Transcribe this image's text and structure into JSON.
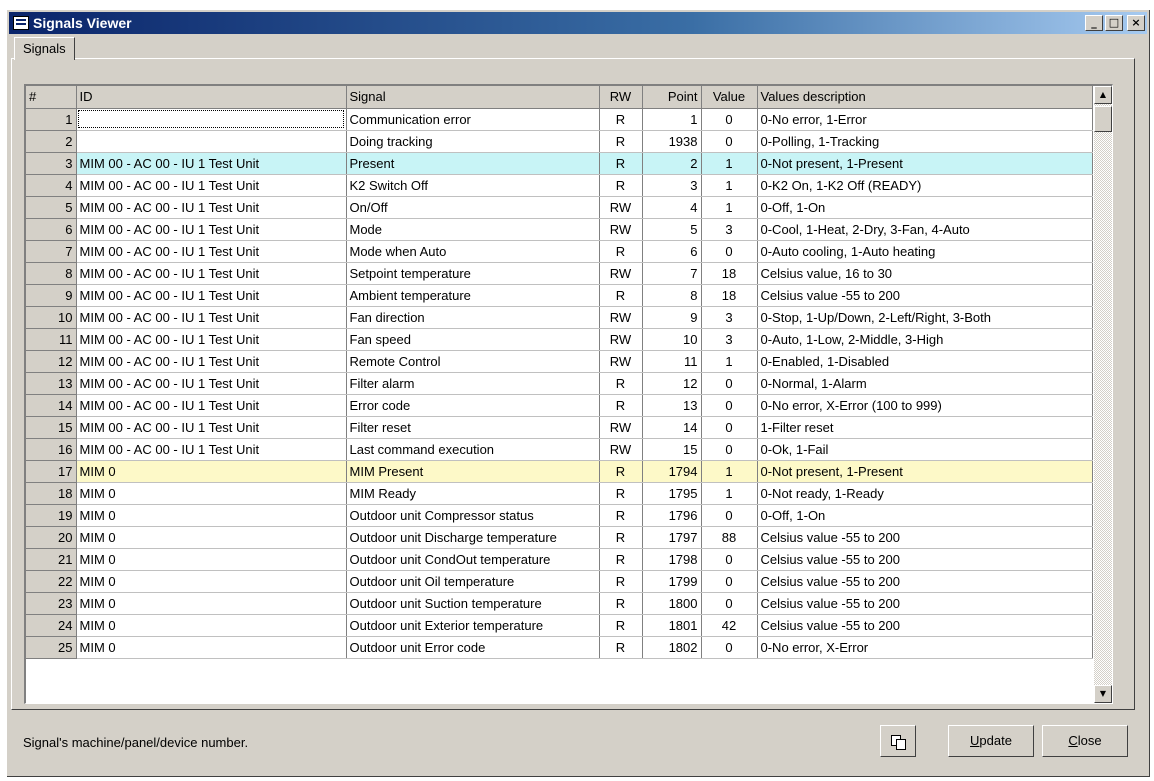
{
  "window": {
    "title": "Signals Viewer",
    "min": "_",
    "max": "□",
    "close": "×"
  },
  "tab": {
    "label": "Signals"
  },
  "table": {
    "columns": [
      "#",
      "ID",
      "Signal",
      "RW",
      "Point",
      "Value",
      "Values description"
    ],
    "rows": [
      [
        "1",
        "",
        "Communication error",
        "R",
        "1",
        "0",
        "0-No error, 1-Error"
      ],
      [
        "2",
        "",
        "Doing tracking",
        "R",
        "1938",
        "0",
        "0-Polling, 1-Tracking"
      ],
      [
        "3",
        "MIM 00 - AC 00 - IU 1 Test Unit",
        "Present",
        "R",
        "2",
        "1",
        "0-Not present, 1-Present"
      ],
      [
        "4",
        "MIM 00 - AC 00 - IU 1 Test Unit",
        "K2 Switch Off",
        "R",
        "3",
        "1",
        "0-K2 On, 1-K2 Off (READY)"
      ],
      [
        "5",
        "MIM 00 - AC 00 - IU 1 Test Unit",
        "On/Off",
        "RW",
        "4",
        "1",
        "0-Off, 1-On"
      ],
      [
        "6",
        "MIM 00 - AC 00 - IU 1 Test Unit",
        "Mode",
        "RW",
        "5",
        "3",
        "0-Cool, 1-Heat, 2-Dry, 3-Fan, 4-Auto"
      ],
      [
        "7",
        "MIM 00 - AC 00 - IU 1 Test Unit",
        "Mode when Auto",
        "R",
        "6",
        "0",
        "0-Auto cooling, 1-Auto heating"
      ],
      [
        "8",
        "MIM 00 - AC 00 - IU 1 Test Unit",
        "Setpoint temperature",
        "RW",
        "7",
        "18",
        "Celsius value, 16 to 30"
      ],
      [
        "9",
        "MIM 00 - AC 00 - IU 1 Test Unit",
        "Ambient temperature",
        "R",
        "8",
        "18",
        "Celsius value -55 to 200"
      ],
      [
        "10",
        "MIM 00 - AC 00 - IU 1 Test Unit",
        "Fan direction",
        "RW",
        "9",
        "3",
        "0-Stop, 1-Up/Down, 2-Left/Right, 3-Both"
      ],
      [
        "11",
        "MIM 00 - AC 00 - IU 1 Test Unit",
        "Fan speed",
        "RW",
        "10",
        "3",
        "0-Auto, 1-Low, 2-Middle, 3-High"
      ],
      [
        "12",
        "MIM 00 - AC 00 - IU 1 Test Unit",
        "Remote Control",
        "RW",
        "11",
        "1",
        "0-Enabled, 1-Disabled"
      ],
      [
        "13",
        "MIM 00 - AC 00 - IU 1 Test Unit",
        "Filter alarm",
        "R",
        "12",
        "0",
        "0-Normal, 1-Alarm"
      ],
      [
        "14",
        "MIM 00 - AC 00 - IU 1 Test Unit",
        "Error code",
        "R",
        "13",
        "0",
        "0-No error, X-Error (100 to 999)"
      ],
      [
        "15",
        "MIM 00 - AC 00 - IU 1 Test Unit",
        "Filter reset",
        "RW",
        "14",
        "0",
        "1-Filter reset"
      ],
      [
        "16",
        "MIM 00 - AC 00 - IU 1 Test Unit",
        "Last command execution",
        "RW",
        "15",
        "0",
        "0-Ok, 1-Fail"
      ],
      [
        "17",
        "MIM 0",
        "MIM Present",
        "R",
        "1794",
        "1",
        "0-Not present, 1-Present"
      ],
      [
        "18",
        "MIM 0",
        "MIM Ready",
        "R",
        "1795",
        "1",
        "0-Not ready, 1-Ready"
      ],
      [
        "19",
        "MIM 0",
        "Outdoor unit Compressor status",
        "R",
        "1796",
        "0",
        "0-Off, 1-On"
      ],
      [
        "20",
        "MIM 0",
        "Outdoor unit Discharge temperature",
        "R",
        "1797",
        "88",
        "Celsius value -55 to 200"
      ],
      [
        "21",
        "MIM 0",
        "Outdoor unit CondOut temperature",
        "R",
        "1798",
        "0",
        "Celsius value -55 to 200"
      ],
      [
        "22",
        "MIM 0",
        "Outdoor unit Oil temperature",
        "R",
        "1799",
        "0",
        "Celsius value -55 to 200"
      ],
      [
        "23",
        "MIM 0",
        "Outdoor unit Suction temperature",
        "R",
        "1800",
        "0",
        "Celsius value -55 to 200"
      ],
      [
        "24",
        "MIM 0",
        "Outdoor unit Exterior temperature",
        "R",
        "1801",
        "42",
        "Celsius value -55 to 200"
      ],
      [
        "25",
        "MIM 0",
        "Outdoor unit Error code",
        "R",
        "1802",
        "0",
        "0-No error, X-Error"
      ]
    ],
    "highlight_blue_row": 3,
    "highlight_yellow_row": 17,
    "highlight_blue_color": "#c8f4f6",
    "highlight_yellow_color": "#fdf9c8"
  },
  "status": {
    "text": "Signal's machine/panel/device number."
  },
  "buttons": {
    "copy_icon": "copy-icon",
    "update_underline": "U",
    "update_rest": "pdate",
    "close_underline": "C",
    "close_rest": "lose"
  }
}
